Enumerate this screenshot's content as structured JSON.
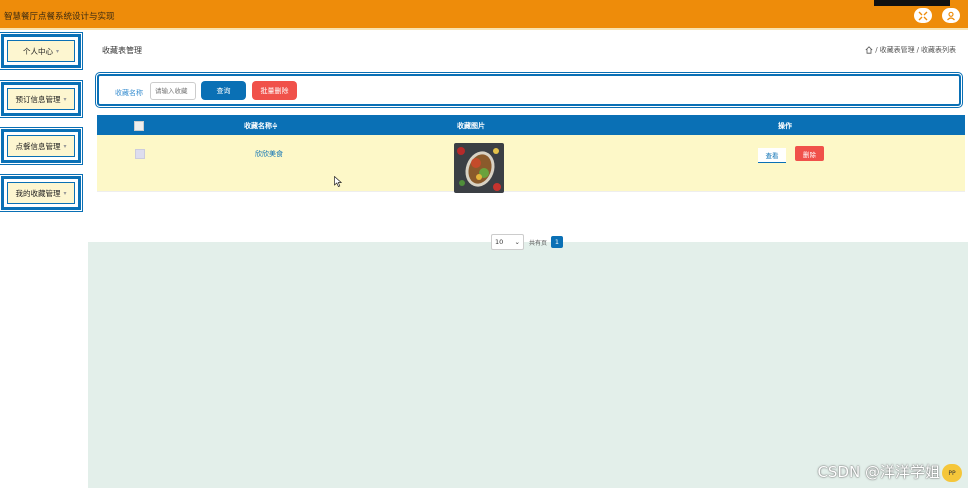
{
  "app": {
    "title": "智慧餐厅点餐系统设计与实现"
  },
  "sidebar": {
    "items": [
      {
        "label": "个人中心"
      },
      {
        "label": "预订信息管理"
      },
      {
        "label": "点餐信息管理"
      },
      {
        "label": "我的收藏管理"
      }
    ]
  },
  "page": {
    "title": "收藏表管理",
    "breadcrumb": {
      "sep1": "/",
      "item1": "收藏表管理",
      "sep2": "/",
      "item2": "收藏表列表"
    }
  },
  "search": {
    "label": "收藏名称",
    "placeholder": "请输入收藏",
    "query_button": "查询",
    "batch_delete_button": "批量删除"
  },
  "table": {
    "headers": [
      "收藏名称≑",
      "收藏图片",
      "操作"
    ],
    "rows": [
      {
        "name": "欣欣美食",
        "view_label": "查看",
        "delete_label": "删除"
      }
    ]
  },
  "pager": {
    "page_size": "10",
    "total_text": "共有页",
    "current_page": "1"
  },
  "watermark": {
    "text": "CSDN @洋洋学姐",
    "badge": "PP"
  },
  "colors": {
    "primary": "#0a70b5",
    "topbar": "#ee8c0a",
    "danger": "#f0514a",
    "row_highlight": "#fdf8c8",
    "content_bg": "#e3efea"
  }
}
